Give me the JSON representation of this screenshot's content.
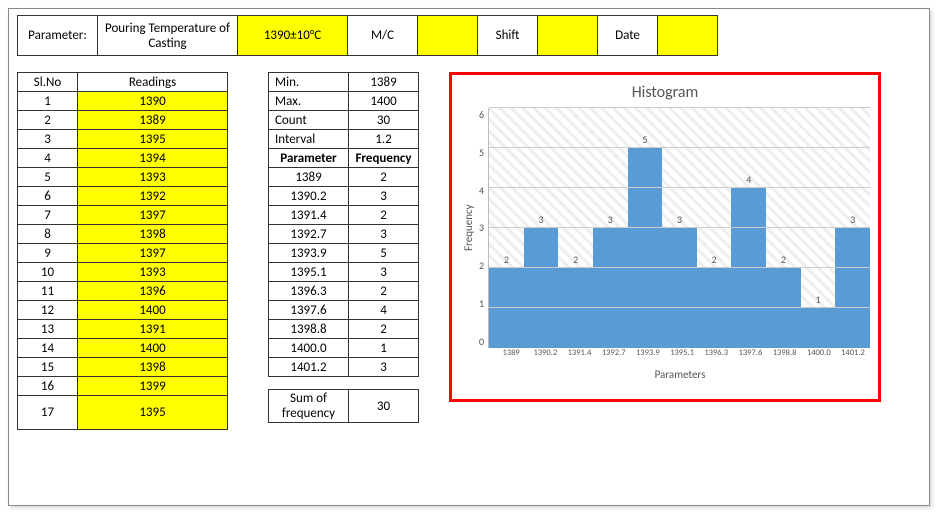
{
  "header": {
    "parameter_label": "Parameter:",
    "parameter_name": "Pouring Temperature of Casting",
    "parameter_value": "1390±10°C",
    "mc_label": "M/C",
    "mc_value": "",
    "shift_label": "Shift",
    "shift_value": "",
    "date_label": "Date",
    "date_value": ""
  },
  "readings": {
    "col_slno": "Sl.No",
    "col_read": "Readings",
    "rows": [
      {
        "n": "1",
        "v": "1390"
      },
      {
        "n": "2",
        "v": "1389"
      },
      {
        "n": "3",
        "v": "1395"
      },
      {
        "n": "4",
        "v": "1394"
      },
      {
        "n": "5",
        "v": "1393"
      },
      {
        "n": "6",
        "v": "1392"
      },
      {
        "n": "7",
        "v": "1397"
      },
      {
        "n": "8",
        "v": "1398"
      },
      {
        "n": "9",
        "v": "1397"
      },
      {
        "n": "10",
        "v": "1393"
      },
      {
        "n": "11",
        "v": "1396"
      },
      {
        "n": "12",
        "v": "1400"
      },
      {
        "n": "13",
        "v": "1391"
      },
      {
        "n": "14",
        "v": "1400"
      },
      {
        "n": "15",
        "v": "1398"
      },
      {
        "n": "16",
        "v": "1399"
      },
      {
        "n": "17",
        "v": "1395"
      }
    ]
  },
  "stats": {
    "min_label": "Min.",
    "min": "1389",
    "max_label": "Max.",
    "max": "1400",
    "count_label": "Count",
    "count": "30",
    "interval_label": "Interval",
    "interval": "1.2",
    "param_header": "Parameter",
    "freq_header": "Frequency",
    "bins": [
      {
        "p": "1389",
        "f": "2"
      },
      {
        "p": "1390.2",
        "f": "3"
      },
      {
        "p": "1391.4",
        "f": "2"
      },
      {
        "p": "1392.7",
        "f": "3"
      },
      {
        "p": "1393.9",
        "f": "5"
      },
      {
        "p": "1395.1",
        "f": "3"
      },
      {
        "p": "1396.3",
        "f": "2"
      },
      {
        "p": "1397.6",
        "f": "4"
      },
      {
        "p": "1398.8",
        "f": "2"
      },
      {
        "p": "1400.0",
        "f": "1"
      },
      {
        "p": "1401.2",
        "f": "3"
      }
    ],
    "sum_label": "Sum of frequency",
    "sum": "30"
  },
  "chart_data": {
    "type": "bar",
    "title": "Histogram",
    "xlabel": "Parameters",
    "ylabel": "Frequency",
    "ylim": [
      0,
      6
    ],
    "categories": [
      "1389",
      "1390.2",
      "1391.4",
      "1392.7",
      "1393.9",
      "1395.1",
      "1396.3",
      "1397.6",
      "1398.8",
      "1400.0",
      "1401.2"
    ],
    "values": [
      2,
      3,
      2,
      3,
      5,
      3,
      2,
      4,
      2,
      1,
      3
    ]
  }
}
